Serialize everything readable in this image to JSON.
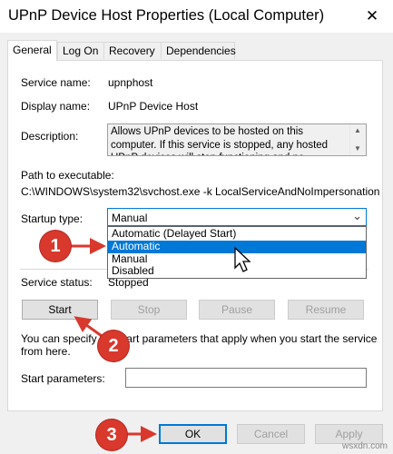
{
  "window": {
    "title": "UPnP Device Host Properties (Local Computer)",
    "close_glyph": "✕"
  },
  "tabs": [
    {
      "label": "General",
      "active": true
    },
    {
      "label": "Log On",
      "active": false
    },
    {
      "label": "Recovery",
      "active": false
    },
    {
      "label": "Dependencies",
      "active": false
    }
  ],
  "fields": {
    "service_name_label": "Service name:",
    "service_name_value": "upnphost",
    "display_name_label": "Display name:",
    "display_name_value": "UPnP Device Host",
    "description_label": "Description:",
    "description_value": "Allows UPnP devices to be hosted on this computer. If this service is stopped, any hosted UPnP devices will stop functioning and no additional hosted",
    "path_label": "Path to executable:",
    "path_value": "C:\\WINDOWS\\system32\\svchost.exe -k LocalServiceAndNoImpersonation",
    "startup_type_label": "Startup type:",
    "startup_type_value": "Manual",
    "startup_options": [
      "Automatic (Delayed Start)",
      "Automatic",
      "Manual",
      "Disabled"
    ],
    "startup_selected_index": 1,
    "service_status_label": "Service status:",
    "service_status_value": "Stopped"
  },
  "service_buttons": {
    "start": "Start",
    "stop": "Stop",
    "pause": "Pause",
    "resume": "Resume"
  },
  "hint_text_line1": "You can specify the start parameters that apply when you start the service",
  "hint_text_line2": "from here.",
  "start_params_label": "Start parameters:",
  "start_params_value": "",
  "dialog_buttons": {
    "ok": "OK",
    "cancel": "Cancel",
    "apply": "Apply"
  },
  "annotations": [
    "1",
    "2",
    "3"
  ],
  "watermark": "wsxdn.com",
  "colors": {
    "accent": "#0078d7",
    "badge": "#d9382d"
  }
}
